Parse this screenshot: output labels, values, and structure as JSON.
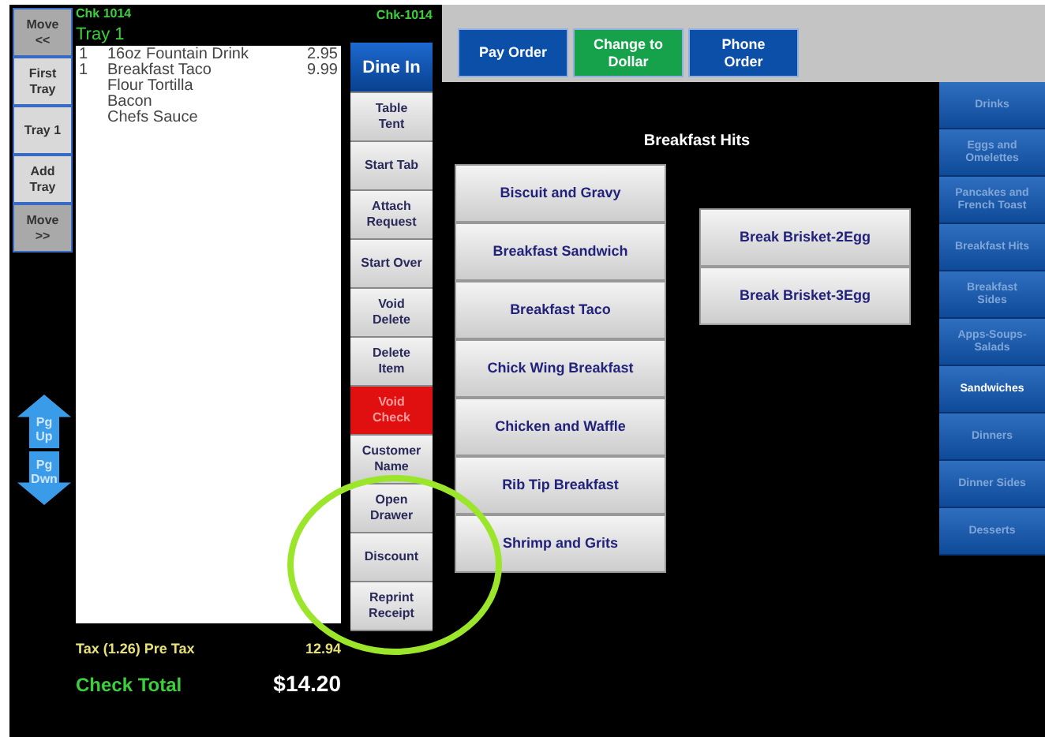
{
  "tray_nav": [
    {
      "label": "Move\n<<",
      "kind": "move"
    },
    {
      "label": "First\nTray",
      "kind": "tray"
    },
    {
      "label": "Tray 1",
      "kind": "tray"
    },
    {
      "label": "Add\nTray",
      "kind": "tray"
    },
    {
      "label": "Move\n>>",
      "kind": "move"
    }
  ],
  "paging": [
    {
      "label": "Pg\nUp",
      "kind": "up"
    },
    {
      "label": "Pg\nDwn",
      "kind": "down"
    }
  ],
  "check": {
    "number": "Chk  1014",
    "tray": "Tray 1",
    "number_right": "Chk-1014",
    "items": [
      {
        "qty": "1",
        "name": "16oz Fountain Drink",
        "price": "2.95"
      },
      {
        "qty": "1",
        "name": "Breakfast Taco",
        "price": "9.99",
        "children": [
          {
            "name": "Flour Tortilla"
          },
          {
            "name": "Bacon"
          },
          {
            "name": "Chefs Sauce"
          }
        ]
      }
    ],
    "tax_label": "Tax (1.26)  Pre Tax",
    "pre_tax": "12.94",
    "total_label": "Check Total",
    "total": "$14.20"
  },
  "actions": [
    {
      "label": "Dine In",
      "kind": "primary"
    },
    {
      "label": "Table\nTent",
      "kind": "normal"
    },
    {
      "label": "Start Tab",
      "kind": "normal"
    },
    {
      "label": "Attach\nRequest",
      "kind": "normal"
    },
    {
      "label": "Start Over",
      "kind": "normal"
    },
    {
      "label": "Void\nDelete",
      "kind": "normal"
    },
    {
      "label": "Delete\nItem",
      "kind": "normal"
    },
    {
      "label": "Void\nCheck",
      "kind": "danger"
    },
    {
      "label": "Customer\nName",
      "kind": "normal"
    },
    {
      "label": "Open\nDrawer",
      "kind": "normal"
    },
    {
      "label": "Discount",
      "kind": "normal"
    },
    {
      "label": "Reprint\nReceipt",
      "kind": "normal"
    }
  ],
  "top_buttons": [
    {
      "label": "Pay Order",
      "color": "#0c4fa8"
    },
    {
      "label": "Change to\nDollar",
      "color": "#16a24a"
    },
    {
      "label": "Phone\nOrder",
      "color": "#0c4fa8"
    }
  ],
  "menu": {
    "title": "Breakfast Hits",
    "columns": [
      [
        "Biscuit and Gravy",
        "Breakfast Sandwich",
        "Breakfast Taco",
        "Chick Wing Breakfast",
        "Chicken and Waffle",
        "Rib Tip Breakfast",
        "Shrimp and Grits"
      ],
      [
        "Break Brisket-2Egg",
        "Break Brisket-3Egg"
      ]
    ]
  },
  "categories": [
    {
      "label": "Drinks",
      "selected": false
    },
    {
      "label": "Eggs and\nOmelettes",
      "selected": false
    },
    {
      "label": "Pancakes and\nFrench Toast",
      "selected": false
    },
    {
      "label": "Breakfast Hits",
      "selected": false
    },
    {
      "label": "Breakfast\nSides",
      "selected": false
    },
    {
      "label": "Apps-Soups-\nSalads",
      "selected": false
    },
    {
      "label": "Sandwiches",
      "selected": true
    },
    {
      "label": "Dinners",
      "selected": false
    },
    {
      "label": "Dinner Sides",
      "selected": false
    },
    {
      "label": "Desserts",
      "selected": false
    }
  ]
}
